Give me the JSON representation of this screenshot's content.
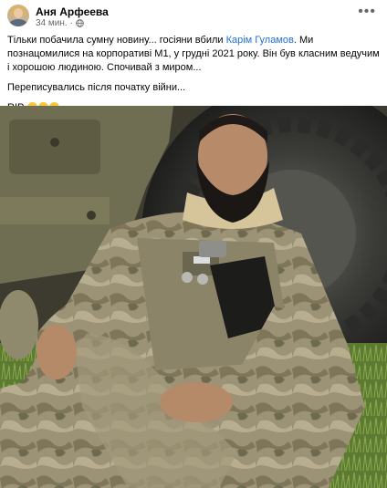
{
  "post": {
    "author": "Аня Арфеева",
    "time": "34 мин.",
    "separator": "·",
    "more_icon": "more-dots-icon",
    "audience_icon": "globe-icon",
    "text": {
      "p1_before": "Тільки побачила сумну новину... госіяни вбили ",
      "p1_link": "Карім Гуламов",
      "p1_after": ". Ми познацомилися на корпоративі М1, у грудні 2021 року. Він був класним ведучим і хорошою людиною. Спочивай з миром...",
      "p2": "Переписувались після початку війни...",
      "p3": "RIP"
    },
    "emoji_icons": [
      "crying-face-icon",
      "crying-face-icon",
      "crying-face-icon"
    ],
    "colors": {
      "link": "#216fdb",
      "meta": "#65676b",
      "text": "#050505"
    }
  }
}
